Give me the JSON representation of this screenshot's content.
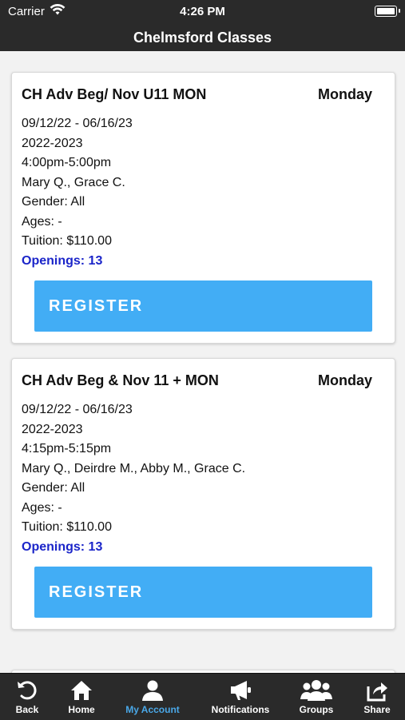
{
  "status": {
    "carrier": "Carrier",
    "time": "4:26 PM"
  },
  "nav": {
    "title": "Chelmsford Classes"
  },
  "classes": [
    {
      "name": "CH Adv Beg/ Nov U11 MON",
      "day": "Monday",
      "dates": "09/12/22 - 06/16/23",
      "season": "2022-2023",
      "time": "4:00pm-5:00pm",
      "instructors": "Mary Q., Grace C.",
      "gender": "Gender: All",
      "ages": "Ages: -",
      "tuition": "Tuition: $110.00",
      "openings": "Openings: 13",
      "register_label": "REGISTER"
    },
    {
      "name": "CH Adv Beg & Nov 11 + MON",
      "day": "Monday",
      "dates": "09/12/22 - 06/16/23",
      "season": "2022-2023",
      "time": "4:15pm-5:15pm",
      "instructors": "Mary Q., Deirdre M., Abby M., Grace C.",
      "gender": "Gender: All",
      "ages": "Ages: -",
      "tuition": "Tuition: $110.00",
      "openings": "Openings: 13",
      "register_label": "REGISTER"
    }
  ],
  "tabs": [
    {
      "label": "Back",
      "icon": "back-icon"
    },
    {
      "label": "Home",
      "icon": "home-icon"
    },
    {
      "label": "My Account",
      "icon": "user-icon",
      "active": true
    },
    {
      "label": "Notifications",
      "icon": "megaphone-icon"
    },
    {
      "label": "Groups",
      "icon": "groups-icon"
    },
    {
      "label": "Share",
      "icon": "share-icon"
    }
  ],
  "colors": {
    "bars": "#2a2a2a",
    "register_button": "#42adf5",
    "openings_text": "#1b25c9",
    "active_tab": "#4aa8e8"
  }
}
